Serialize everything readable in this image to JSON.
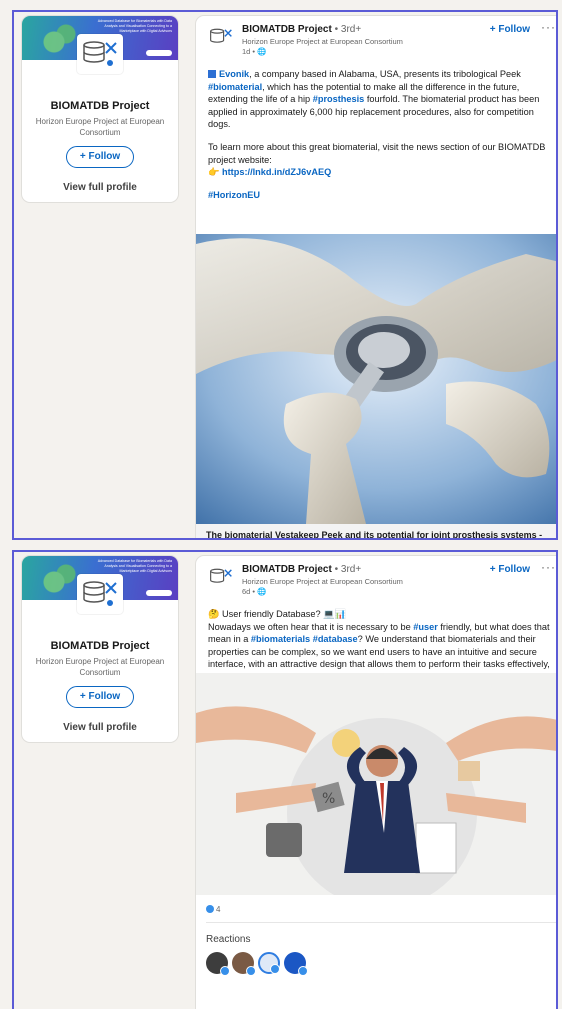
{
  "profile": {
    "banner_tagline": "Advanced Database for Biomaterials with Data Analysis and Visualisation Connecting to a Marketplace with Digital Advisors",
    "name": "BIOMATDB Project",
    "subtitle": "Horizon Europe Project at European Consortium",
    "follow_label": "+ Follow",
    "view_profile_label": "View full profile"
  },
  "post1": {
    "author": "BIOMATDB Project",
    "degree": "• 3rd+",
    "headline": "Horizon Europe Project at European Consortium",
    "time": "1d •",
    "follow_label": "+ Follow",
    "more": "···",
    "p1_company": "Evonik",
    "p1_text_a": ", a company based in Alabama, USA, presents its tribological Peek ",
    "p1_tag_a": "#biomaterial",
    "p1_text_b": ", which has the potential to make all the difference in the future, extending the life of a hip ",
    "p1_tag_b": "#prosthesis",
    "p1_text_c": " fourfold. The biomaterial product has been applied in approximately 6,000 hip replacement procedures, also for competition dogs.",
    "p2_text": "To learn more about this great biomaterial, visit the news section of our BIOMATDB project website:",
    "p2_link": "https://lnkd.in/dZJ6vAEQ",
    "hashtag": "#HorizonEU",
    "caption": "The biomaterial Vestakeep Peek and its potential for joint prosthesis systems - BIOMATDB"
  },
  "post2": {
    "author": "BIOMATDB Project",
    "degree": "• 3rd+",
    "headline": "Horizon Europe Project at European Consortium",
    "time": "6d •",
    "follow_label": "+ Follow",
    "more": "···",
    "title_line": "User friendly Database? 💻📊",
    "t_a": "Nowadays we often hear that it is necessary to be ",
    "tag_user": "#user",
    "t_b": " friendly, but what does that mean in a ",
    "tag_bio": "#biomaterials",
    "tag_db": "#database",
    "t_c": "? We understand that biomaterials and their properties can be complex, so we want end users to have an intuitive and secure interface, with an attractive design that allows them to perform their tasks effectively, to focus on what really matters: the patient's wellbeing.",
    "reaction_count": "4",
    "reactions_title": "Reactions"
  },
  "colors": {
    "accent": "#0a66c2",
    "frame": "#5b5bd6"
  }
}
